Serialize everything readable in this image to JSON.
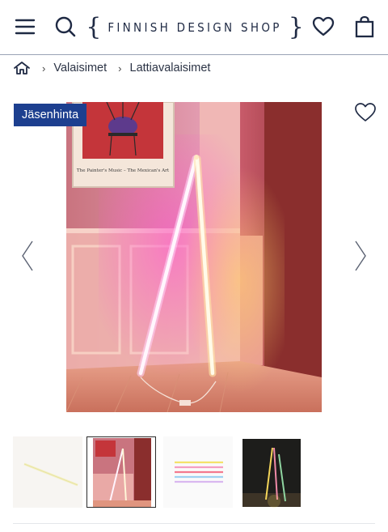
{
  "header": {
    "brand_name": "FINNISH DESIGN SHOP",
    "brace_left": "{",
    "brace_right": "}",
    "icons": [
      "menu-icon",
      "search-icon",
      "heart-icon",
      "shopping-bag-icon"
    ]
  },
  "breadcrumb": {
    "home_icon": "home-icon",
    "items": [
      "Valaisimet",
      "Lattiavalaisimet"
    ],
    "separator": "›"
  },
  "gallery": {
    "badge": "Jäsenhinta",
    "poster_caption": "The Painter's Music – The Mexican's Art",
    "wishlist_icon": "heart-outline-icon",
    "prev_icon": "chevron-left-icon",
    "next_icon": "chevron-right-icon",
    "active_thumb_index": 1,
    "thumbs": [
      "thumb-lamp-white-background",
      "thumb-lamp-corner-room",
      "thumb-colored-tubes",
      "thumb-lamps-dark-room"
    ]
  },
  "colors": {
    "brand_navy": "#1f2a44",
    "badge_blue": "#1d3f8f",
    "divider": "#9aa3b5"
  }
}
